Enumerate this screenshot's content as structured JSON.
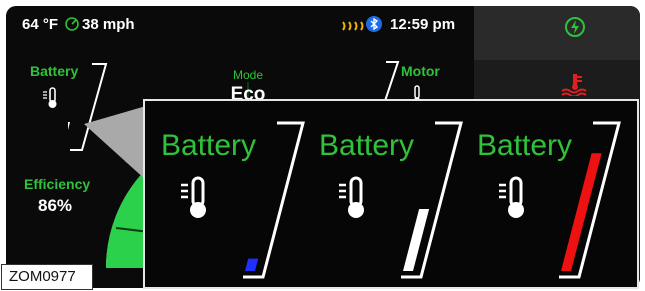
{
  "status_bar": {
    "outside_temp": "64 °F",
    "speed": "38 mph",
    "time": "12:59 pm",
    "icons": [
      "eco-speed-icon",
      "wiper-heat-icon",
      "bluetooth-icon"
    ]
  },
  "gauge": {
    "mode_label": "Mode",
    "mode_value": "Eco"
  },
  "left_panel": {
    "battery_label": "Battery",
    "efficiency_label": "Efficiency",
    "efficiency_value": "86%"
  },
  "right_panel": {
    "motor_label": "Motor",
    "icons": [
      "charge-plug-icon",
      "coolant-temp-icon"
    ]
  },
  "inset": {
    "panels": [
      {
        "label": "Battery",
        "level": 0.1,
        "color": "#1f2fff"
      },
      {
        "label": "Battery",
        "level": 0.5,
        "color": "#ffffff"
      },
      {
        "label": "Battery",
        "level": 0.95,
        "color": "#ee1111"
      }
    ]
  },
  "caption": "ZOM0977",
  "colors": {
    "accent_green": "#2fc23a",
    "warning_red": "#e02020",
    "gauge_green": "#2bd14a"
  }
}
